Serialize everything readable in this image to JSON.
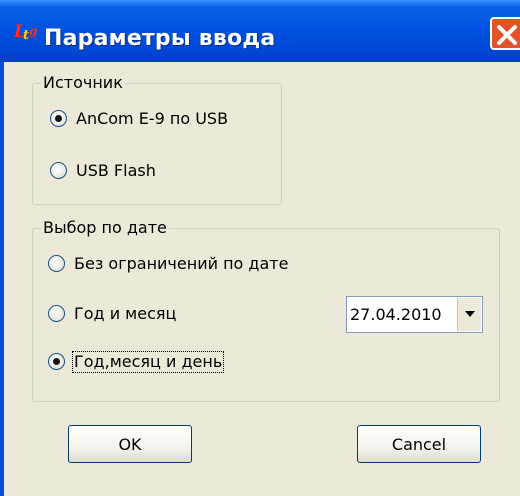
{
  "window": {
    "title": "Параметры ввода"
  },
  "source_group": {
    "legend": "Источник",
    "options": [
      {
        "label": "AnCom  E-9 по USB",
        "selected": true
      },
      {
        "label": "USB Flash",
        "selected": false
      }
    ]
  },
  "date_group": {
    "legend": "Выбор по дате",
    "options": [
      {
        "label": "Без ограничений по дате",
        "selected": false
      },
      {
        "label": "Год и месяц",
        "selected": false
      },
      {
        "label": "Год,месяц и день",
        "selected": true
      }
    ],
    "date_value": "27.04.2010"
  },
  "buttons": {
    "ok": "OK",
    "cancel": "Cancel"
  },
  "colors": {
    "titlebar": "#0053e0",
    "face": "#ece9d8",
    "close": "#e4522b"
  }
}
